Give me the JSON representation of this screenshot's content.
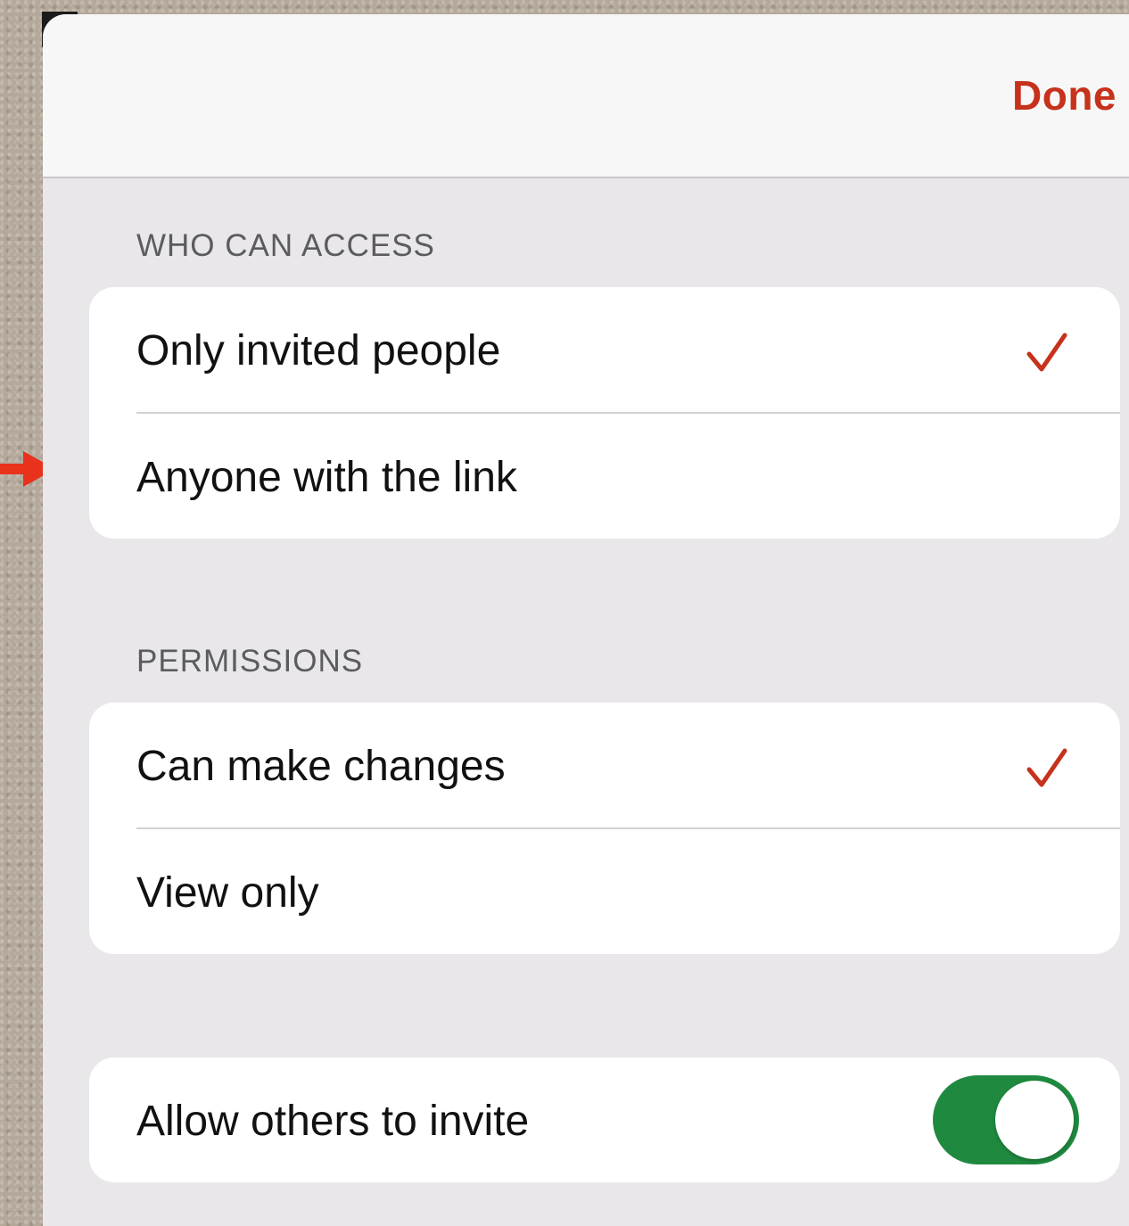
{
  "navbar": {
    "done_label": "Done"
  },
  "who_can_access": {
    "header": "WHO CAN ACCESS",
    "options": [
      {
        "label": "Only invited people",
        "selected": true
      },
      {
        "label": "Anyone with the link",
        "selected": false
      }
    ]
  },
  "permissions": {
    "header": "PERMISSIONS",
    "options": [
      {
        "label": "Can make changes",
        "selected": true
      },
      {
        "label": "View only",
        "selected": false
      }
    ]
  },
  "invite": {
    "label": "Allow others to invite",
    "toggle_on": true
  },
  "colors": {
    "accent": "#c6321c",
    "toggle_on": "#1f8a3f",
    "arrow": "#e8321c"
  },
  "icons": {
    "checkmark": "checkmark-icon",
    "arrow": "arrow-right-icon"
  }
}
